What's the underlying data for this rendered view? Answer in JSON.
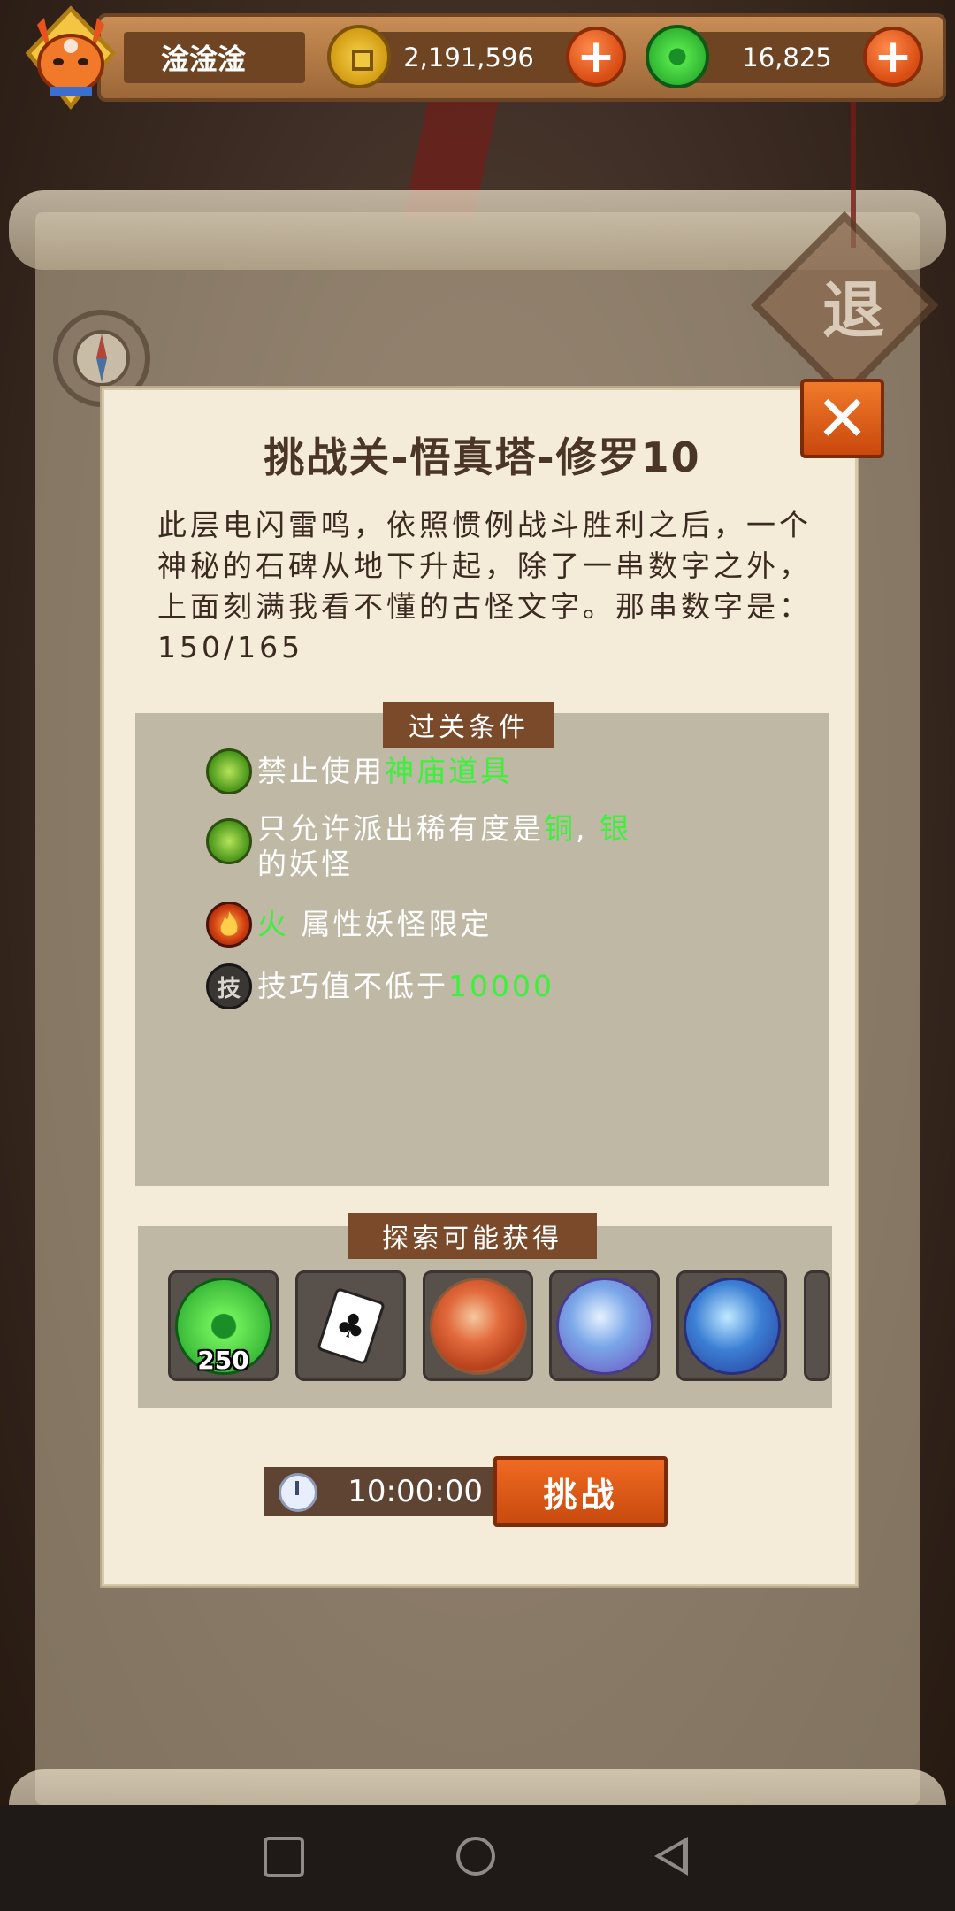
{
  "player": {
    "name": "淦淦淦"
  },
  "currency": {
    "coins": "2,191,596",
    "jade": "16,825"
  },
  "background": {
    "exit_label": "退"
  },
  "modal": {
    "title": "挑战关-悟真塔-修罗10",
    "description": "此层电闪雷鸣，依照惯例战斗胜利之后，一个神秘的石碑从地下升起，除了一串数字之外，上面刻满我看不懂的古怪文字。那串数字是：150/165",
    "conditions_header": "过关条件",
    "conditions": [
      {
        "icon": "green-swirl-icon",
        "text": "禁止使用",
        "highlight": "神庙道具",
        "suffix": ""
      },
      {
        "icon": "green-swirl-icon",
        "text": "只允许派出稀有度是",
        "highlight": "铜",
        "sep": ",",
        "highlight2": "银",
        "suffix": "的妖怪"
      },
      {
        "icon": "fire-icon",
        "text": "",
        "highlight": "火",
        "suffix": "属性妖怪限定"
      },
      {
        "icon": "skill-icon",
        "icon_label": "技",
        "text": "技巧值不低于",
        "highlight": "10000",
        "suffix": ""
      }
    ],
    "rewards_header": "探索可能获得",
    "rewards": [
      {
        "icon": "jade-icon",
        "count": "250"
      },
      {
        "icon": "card-icon"
      },
      {
        "icon": "red-orb-icon"
      },
      {
        "icon": "cube-orb-icon"
      },
      {
        "icon": "shard-orb-icon"
      }
    ],
    "timer": "10:00:00",
    "challenge_label": "挑战",
    "close_label": "✕"
  },
  "colors": {
    "highlight": "#3cf03c",
    "accent_orange": "#e0601a",
    "panel_brown": "#7b4a2a"
  }
}
